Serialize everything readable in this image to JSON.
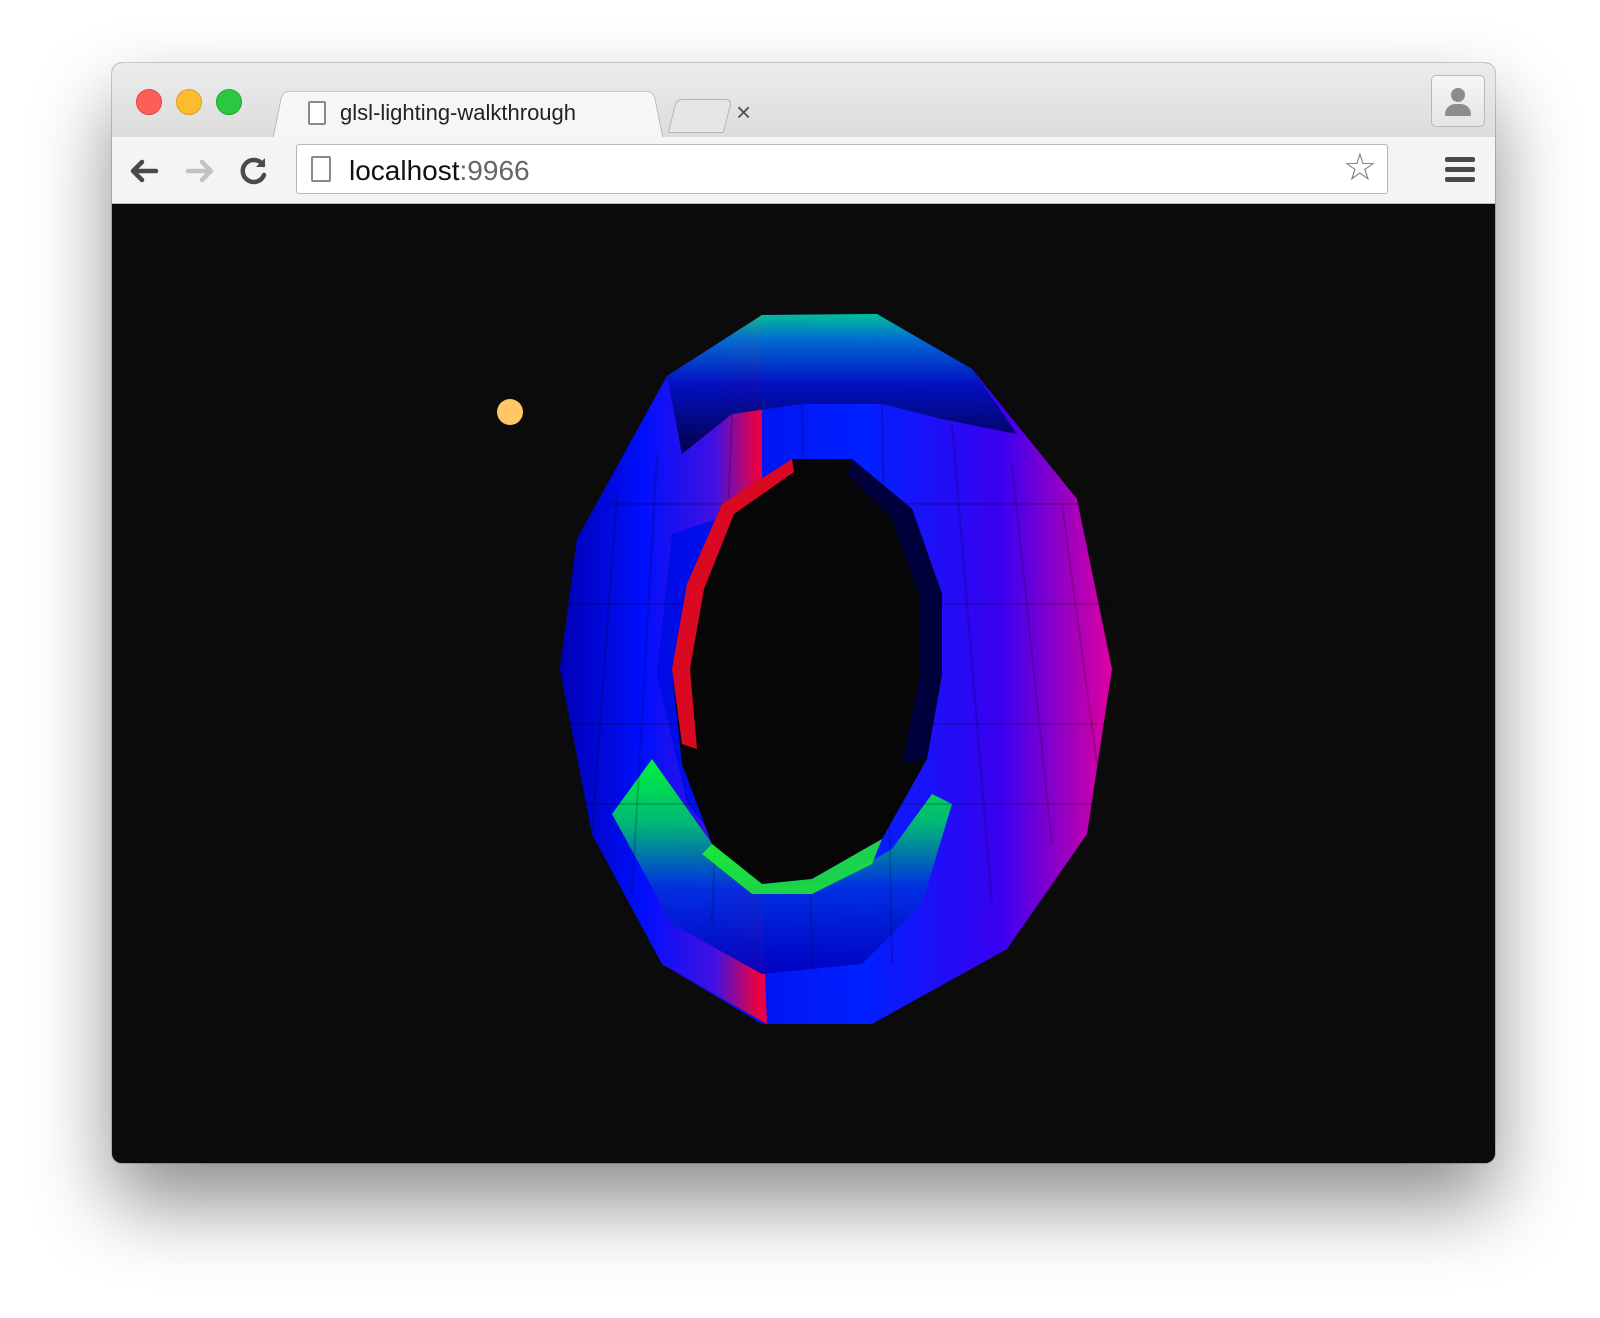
{
  "window": {
    "traffic_lights": {
      "close": "#fc5f57",
      "minimize": "#fdbc2e",
      "maximize": "#29c840"
    }
  },
  "tab": {
    "title": "glsl-lighting-walkthrough",
    "close_glyph": "×",
    "icon": "page-icon"
  },
  "toolbar": {
    "back_glyph": "🡐",
    "forward_glyph": "🡒",
    "reload_glyph": "↻",
    "url_host": "localhost",
    "url_port": ":9966",
    "star_glyph": "☆",
    "menu_icon": "hamburger-menu-icon",
    "profile_icon": "profile-icon"
  },
  "scene": {
    "background": "#0b0b0b",
    "light_color": "#ffc766",
    "mesh": "torus",
    "palette": [
      "#0000ff",
      "#1a00e6",
      "#7b00d6",
      "#ff0040",
      "#00e5ff",
      "#00ff40",
      "#00ff00"
    ]
  }
}
